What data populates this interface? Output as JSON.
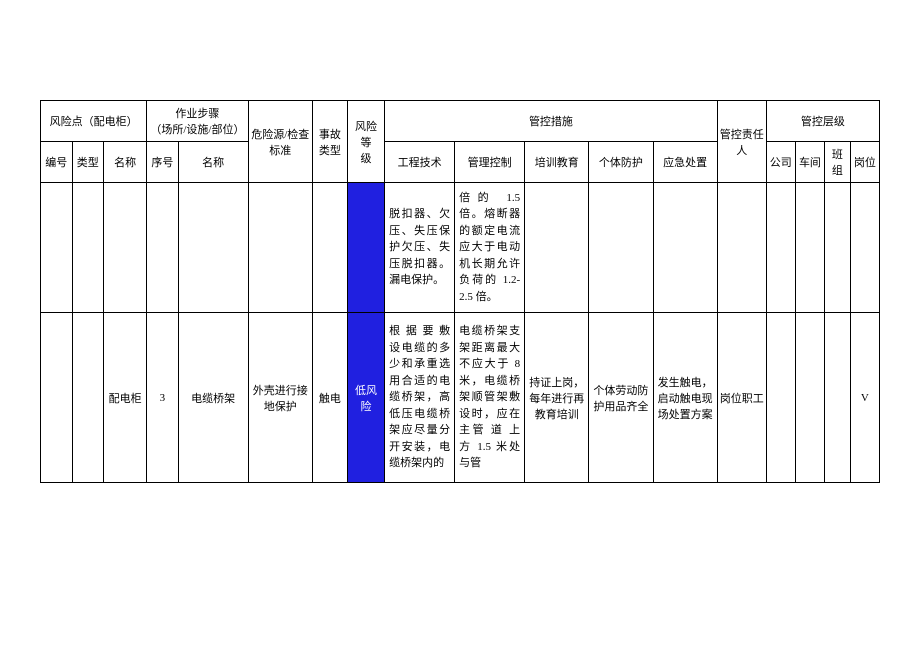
{
  "headers": {
    "risk_point": "风险点（配电柜）",
    "work_steps": "作业步骤\n（场所/设施/部位）",
    "hazard_std": "危险源/检查\n标准",
    "accident_type": "事故\n类型",
    "risk_level": "风险等\n级",
    "control_measures": "管控措施",
    "control_person": "管控责任人",
    "control_level": "管控层级",
    "sub": {
      "id": "编号",
      "type": "类型",
      "name": "名称",
      "seq": "序号",
      "step_name": "名称",
      "eng_tech": "工程技术",
      "mgmt_ctrl": "管理控制",
      "training": "培训教育",
      "ppe": "个体防护",
      "emergency": "应急处置",
      "company": "公司",
      "workshop": "车间",
      "team": "班组",
      "post": "岗位"
    }
  },
  "row1": {
    "eng_tech": "脱扣器、欠压、失压保护欠压、失压脱扣器。漏电保护。",
    "mgmt_ctrl": "倍的 1.5 倍。熔断器的额定电流应大于电动机长期允许负荷的 1.2-2.5 倍。"
  },
  "row2": {
    "name": "配电柜",
    "seq": "3",
    "step_name": "电缆桥架",
    "hazard_std": "外壳进行接地保护",
    "accident_type": "触电",
    "risk_level": "低风险",
    "eng_tech": "根 据 要 敷设电缆的多少和承重选用合适的电缆桥架，高低压电缆桥架应尽量分开安装，电缆桥架内的",
    "mgmt_ctrl": "电缆桥架支架距离最大不应大于 8 米，电缆桥架顺管架敷设时，应在主管 道 上 方 1.5 米处与管",
    "training": "持证上岗，每年进行再教育培训",
    "ppe": "个体劳动防护用品齐全",
    "emergency": "发生触电，启动触电现场处置方案",
    "person": "岗位职工",
    "post_mark": "V"
  }
}
